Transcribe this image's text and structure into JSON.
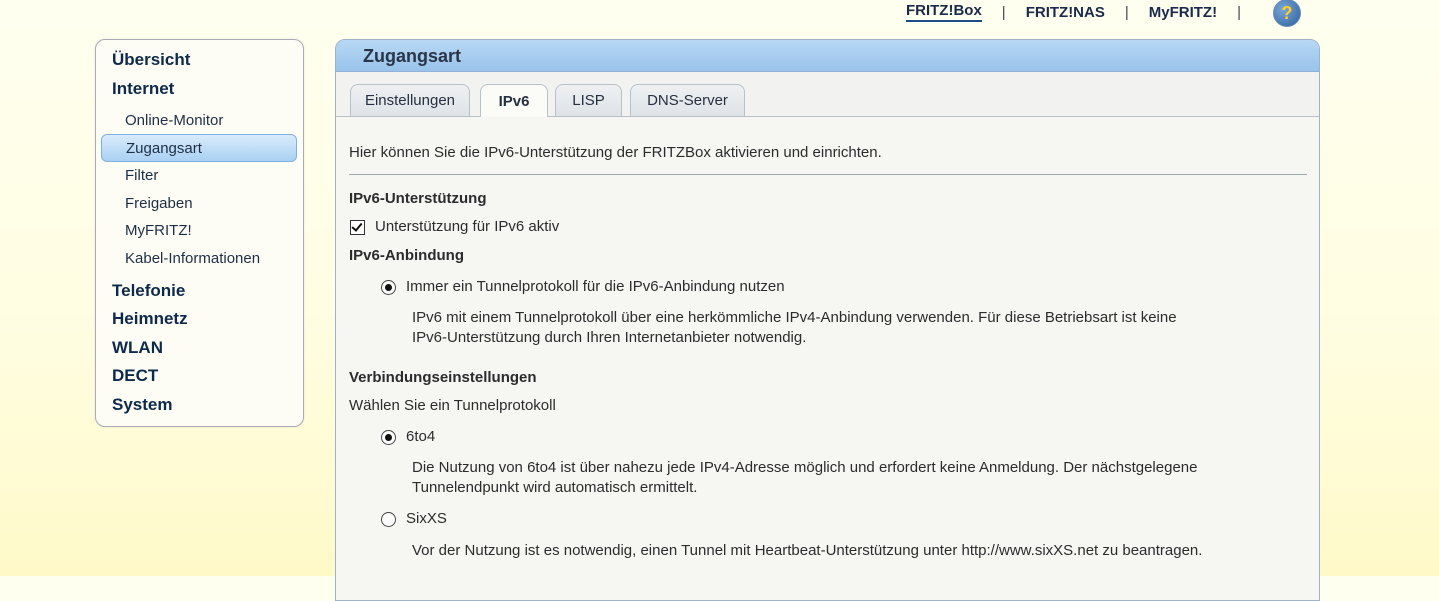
{
  "topnav": {
    "fritzbox": "FRITZ!Box",
    "fritznas": "FRITZ!NAS",
    "myfritz": "MyFRITZ!",
    "sep": "|",
    "help": "?"
  },
  "sidebar": {
    "uebersicht": "Übersicht",
    "internet": "Internet",
    "sub": {
      "online_monitor": "Online-Monitor",
      "zugangsart": "Zugangsart",
      "filter": "Filter",
      "freigaben": "Freigaben",
      "myfritz": "MyFRITZ!",
      "kabel": "Kabel-Informationen"
    },
    "telefonie": "Telefonie",
    "heimnetz": "Heimnetz",
    "wlan": "WLAN",
    "dect": "DECT",
    "system": "System"
  },
  "panel": {
    "title": "Zugangsart",
    "tabs": {
      "einstellungen": "Einstellungen",
      "ipv6": "IPv6",
      "lisp": "LISP",
      "dns": "DNS-Server"
    },
    "intro": "Hier können Sie die IPv6-Unterstützung der FRITZBox aktivieren und einrichten.",
    "support_heading": "IPv6-Unterstützung",
    "support_checkbox": "Unterstützung für IPv6 aktiv",
    "binding_heading": "IPv6-Anbindung",
    "binding_option": "Immer ein Tunnelprotokoll für die IPv6-Anbindung nutzen",
    "binding_desc_1": "IPv6 mit einem Tunnelprotokoll über eine herkömmliche IPv4-Anbindung verwenden. Für diese Betriebsart ist keine",
    "binding_desc_2": "IPv6-Unterstützung durch Ihren Internetanbieter notwendig.",
    "conn_heading": "Verbindungseinstellungen",
    "conn_sub": "Wählen Sie ein Tunnelprotokoll",
    "opt_6to4": "6to4",
    "desc_6to4_1": "Die Nutzung von 6to4 ist über nahezu jede IPv4-Adresse möglich und erfordert keine Anmeldung. Der nächstgelegene",
    "desc_6to4_2": "Tunnelendpunkt wird automatisch ermittelt.",
    "opt_sixxs": "SixXS",
    "desc_sixxs": "Vor der Nutzung ist es notwendig, einen Tunnel mit Heartbeat-Unterstützung unter http://www.sixXS.net zu beantragen."
  }
}
